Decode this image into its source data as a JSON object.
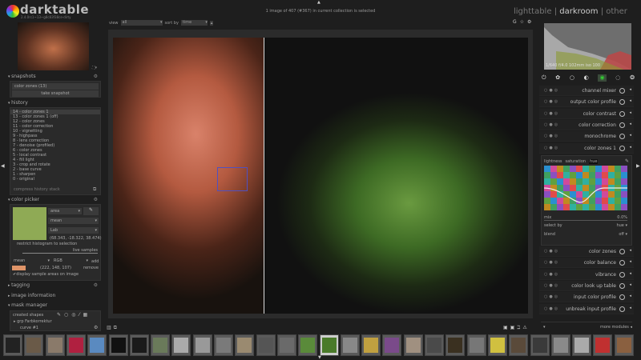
{
  "app": {
    "name": "darktable",
    "version": "2.4.0rc1~13~g8c83f38ce-dirty"
  },
  "header": {
    "status": "1 image of 407 (#367) in current collection is selected",
    "views": [
      "lighttable",
      "darkroom",
      "other"
    ],
    "separator": "|",
    "active_view": "darkroom"
  },
  "topbar": {
    "view_label": "view",
    "view_value": "all",
    "sort_label": "sort by",
    "sort_value": "time",
    "sort_dir": "▴"
  },
  "snapshots": {
    "title": "snapshots",
    "items": [
      "color zones (13)"
    ],
    "take": "take snapshot"
  },
  "history": {
    "title": "history",
    "items": [
      "14 - color zones 1",
      "13 - color zones 1 (off)",
      "12 - color zones",
      "11 - color correction",
      "10 - vignetting",
      "9 - highpass",
      "8 - lens correction",
      "7 - denoise (profiled)",
      "6 - color zones",
      "5 - local contrast",
      "4 - fill light",
      "3 - crop and rotate",
      "2 - base curve",
      "1 - sharpen",
      "0 - original"
    ],
    "selected": 0,
    "compress": "compress history stack"
  },
  "color_picker": {
    "title": "color picker",
    "swatch": "#8faa55",
    "mode": "area",
    "stat": "mean",
    "space": "Lab",
    "values": "(68.343, -18.322, 38.474)",
    "restrict": "restrict histogram to selection",
    "live_samples": "live samples",
    "sample_stat": "mean",
    "sample_space": "RGB",
    "add": "add",
    "sample_color": "#de9468",
    "sample_values": "(222, 148, 107)",
    "remove": "remove",
    "display_check": "display sample areas on image"
  },
  "panels": {
    "tagging": "tagging",
    "image_information": "image information",
    "mask_manager": "mask manager"
  },
  "mask_manager": {
    "created_shapes": "created shapes",
    "group": "grp Farbkorrektur",
    "curve": "curve #1"
  },
  "histogram": {
    "exif": "1/640 f/4.0 102mm iso 100"
  },
  "modules": [
    {
      "name": "channel mixer"
    },
    {
      "name": "output color profile"
    },
    {
      "name": "color contrast"
    },
    {
      "name": "color correction"
    },
    {
      "name": "monochrome"
    },
    {
      "name": "color zones 1"
    }
  ],
  "color_zones_panel": {
    "tabs": [
      "lightness",
      "saturation",
      "hue"
    ],
    "active_tab": "hue",
    "mix_label": "mix",
    "mix_value": "0.0%",
    "select_by_label": "select by",
    "select_by_value": "hue",
    "blend_label": "blend",
    "blend_value": "off"
  },
  "modules_after": [
    {
      "name": "color zones"
    },
    {
      "name": "color balance"
    },
    {
      "name": "vibrance"
    },
    {
      "name": "color look up table"
    },
    {
      "name": "input color profile"
    },
    {
      "name": "unbreak input profile"
    }
  ],
  "more_modules": "more modules",
  "colors": {
    "accent": "#e06030",
    "background": "#1e1e1e",
    "panel": "#2a2a2a"
  }
}
